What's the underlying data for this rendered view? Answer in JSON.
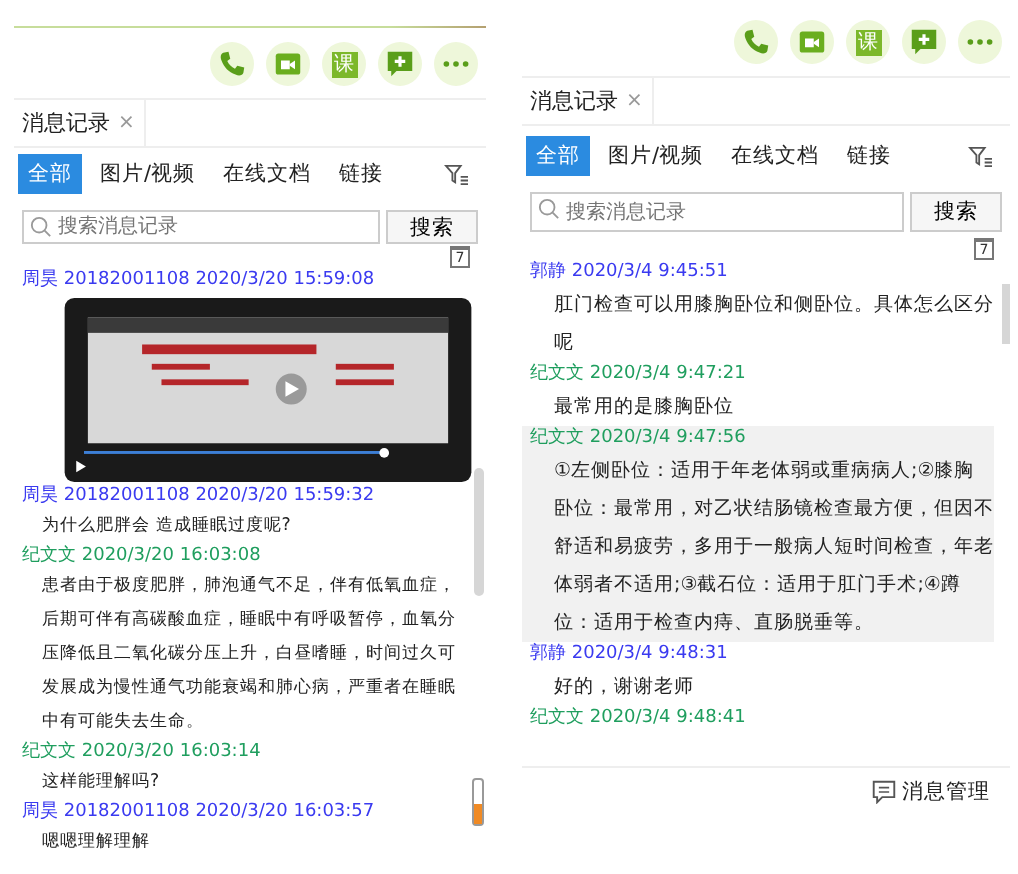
{
  "panels": [
    {
      "accent_line": true,
      "toolbar": [
        {
          "kind": "phone"
        },
        {
          "kind": "video"
        },
        {
          "kind": "text",
          "label": "课"
        },
        {
          "kind": "add-chat"
        },
        {
          "kind": "more"
        }
      ],
      "history_tab": {
        "label": "消息记录",
        "close": "×"
      },
      "filters": [
        {
          "label": "全部",
          "selected": true
        },
        {
          "label": "图片/视频",
          "selected": false
        },
        {
          "label": "在线文档",
          "selected": false
        },
        {
          "label": "链接",
          "selected": false
        }
      ],
      "search": {
        "placeholder": "搜索消息记录",
        "button": "搜索"
      },
      "calendar": "7",
      "messages": [
        {
          "sender": "周昊 20182001108 2020/3/20 15:59:08",
          "color": "#3a3af0",
          "kind": "video",
          "selected": false
        },
        {
          "sender": "周昊 20182001108 2020/3/20 15:59:32",
          "color": "#3a3af0",
          "kind": "text",
          "text": "为什么肥胖会 造成睡眠过度呢?",
          "selected": false
        },
        {
          "sender": "纪文文 2020/3/20 16:03:08",
          "color": "#1f9e5e",
          "kind": "text",
          "text": "患者由于极度肥胖，肺泡通气不足，伴有低氧血症，后期可伴有高碳酸血症，睡眠中有呼吸暂停，血氧分压降低且二氧化碳分压上升，白昼嗜睡，时间过久可发展成为慢性通气功能衰竭和肺心病，严重者在睡眠中有可能失去生命。",
          "selected": false
        },
        {
          "sender": "纪文文 2020/3/20 16:03:14",
          "color": "#1f9e5e",
          "kind": "text",
          "text": "这样能理解吗?",
          "selected": false
        },
        {
          "sender": "周昊 20182001108 2020/3/20 16:03:57",
          "color": "#3a3af0",
          "kind": "text",
          "text": "嗯嗯理解理解",
          "selected": false
        }
      ]
    },
    {
      "toolbar": [
        {
          "kind": "phone"
        },
        {
          "kind": "video"
        },
        {
          "kind": "text",
          "label": "课"
        },
        {
          "kind": "add-chat"
        },
        {
          "kind": "more"
        }
      ],
      "history_tab": {
        "label": "消息记录",
        "close": "×"
      },
      "filters": [
        {
          "label": "全部",
          "selected": true
        },
        {
          "label": "图片/视频",
          "selected": false
        },
        {
          "label": "在线文档",
          "selected": false
        },
        {
          "label": "链接",
          "selected": false
        }
      ],
      "search": {
        "placeholder": "搜索消息记录",
        "button": "搜索"
      },
      "calendar": "7",
      "messages": [
        {
          "sender": "郭静 2020/3/4 9:45:51",
          "color": "#3a3af0",
          "kind": "text",
          "text": "肛门检查可以用膝胸卧位和侧卧位。具体怎么区分呢",
          "selected": false
        },
        {
          "sender": "纪文文 2020/3/4 9:47:21",
          "color": "#1f9e5e",
          "kind": "text",
          "text": "最常用的是膝胸卧位",
          "selected": false
        },
        {
          "sender": "纪文文 2020/3/4 9:47:56",
          "color": "#1f9e5e",
          "kind": "text",
          "text": "①左侧卧位：适用于年老体弱或重病病人;②膝胸卧位：最常用，对乙状结肠镜检查最方便，但因不舒适和易疲劳，多用于一般病人短时间检查，年老体弱者不适用;③截石位：适用于肛门手术;④蹲位：适用于检查内痔、直肠脱垂等。",
          "selected": true
        },
        {
          "sender": "郭静 2020/3/4 9:48:31",
          "color": "#3a3af0",
          "kind": "text",
          "text": "好的，谢谢老师",
          "selected": false
        },
        {
          "sender": "纪文文 2020/3/4 9:48:41",
          "color": "#1f9e5e",
          "kind": "text",
          "selected": false
        }
      ],
      "footer": {
        "label": "消息管理"
      }
    }
  ]
}
